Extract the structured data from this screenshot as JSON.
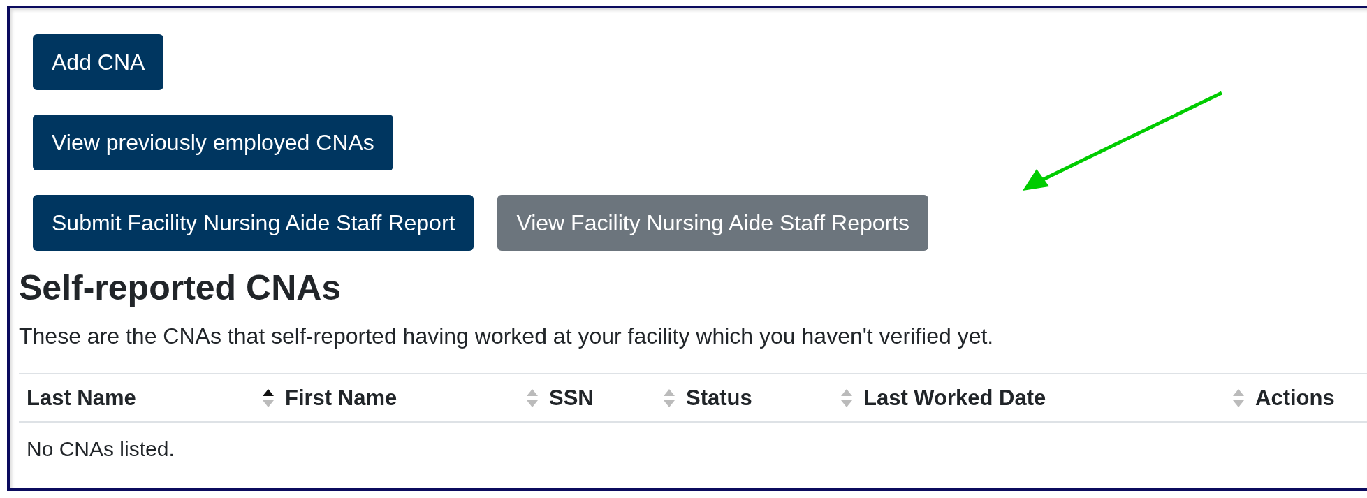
{
  "buttons": [
    {
      "label": "Add CNA",
      "kind": "primary"
    },
    {
      "label": "View previously employed CNAs",
      "kind": "primary"
    },
    {
      "label": "Submit Facility Nursing Aide Staff Report",
      "kind": "primary"
    },
    {
      "label": "View Facility Nursing Aide Staff Reports",
      "kind": "secondary"
    }
  ],
  "section": {
    "title": "Self-reported CNAs",
    "description": "These are the CNAs that self-reported having worked at your facility which you haven't verified yet."
  },
  "table": {
    "columns": [
      {
        "label": "Last Name",
        "sorted": true
      },
      {
        "label": "First Name",
        "sorted": false
      },
      {
        "label": "SSN",
        "sorted": false
      },
      {
        "label": "Status",
        "sorted": false
      },
      {
        "label": "Last Worked Date",
        "sorted": false
      },
      {
        "label": "Actions"
      }
    ],
    "empty_message": "No CNAs listed."
  }
}
